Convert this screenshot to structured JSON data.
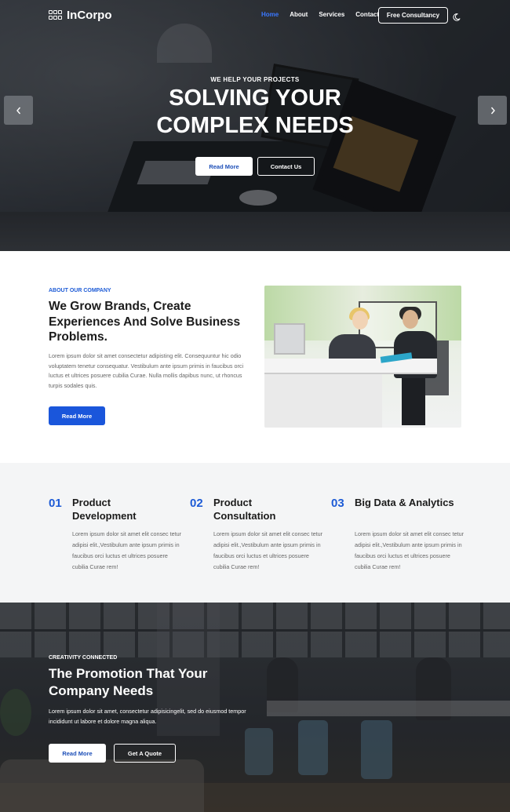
{
  "nav": {
    "brand": "InCorpo",
    "links": [
      "Home",
      "About",
      "Services",
      "Contact"
    ],
    "active_link": "Home",
    "cta_label": "Free Consultancy",
    "theme_icon": "moon-icon"
  },
  "hero": {
    "subtitle": "WE HELP YOUR PROJECTS",
    "title_line1": "SOLVING YOUR",
    "title_line2": "COMPLEX NEEDS",
    "primary_button": "Read More",
    "secondary_button": "Contact Us",
    "prev_icon": "chevron-left-icon",
    "next_icon": "chevron-right-icon"
  },
  "about": {
    "eyebrow": "ABOUT OUR COMPANY",
    "title": "We Grow Brands, Create Experiences And Solve Business Problems.",
    "text": "Lorem ipsum dolor sit amet consectetur adipisting elit. Consequuntur hic odio voluptatem tenetur consequatur. Vestibulum ante ipsum primis in faucibus orci luctus et ultrices posuere cubilia Curae. Nulla mollis dapibus nunc, ut rhoncus turpis sodales quis.",
    "button": "Read More"
  },
  "services": [
    {
      "number": "01",
      "title": "Product Development",
      "text": "Lorem ipsum dolor sit amet elit consec tetur adipisi elit.,Vestibulum ante ipsum primis in faucibus orci luctus et ultrices posuere cubilia Curae rem!"
    },
    {
      "number": "02",
      "title": "Product Consultation",
      "text": "Lorem ipsum dolor sit amet elit consec tetur adipisi elit.,Vestibulum ante ipsum primis in faucibus orci luctus et ultrices posuere cubilia Curae rem!"
    },
    {
      "number": "03",
      "title": "Big Data & Analytics",
      "text": "Lorem ipsum dolor sit amet elit consec tetur adipisi elit.,Vestibulum ante ipsum primis in faucibus orci luctus et ultrices posuere cubilia Curae rem!"
    }
  ],
  "promo": {
    "eyebrow": "CREATIVITY CONNECTED",
    "title": "The Promotion That Your Company Needs",
    "text": "Lorem ipsum dolor sit amet, consectetur adipisicingelit, sed do eiusmod tempor incididunt ut labore et dolore magna aliqua.",
    "primary_button": "Read More",
    "secondary_button": "Get A Quote"
  },
  "colors": {
    "accent": "#1a56db",
    "active_nav": "#3a78ff",
    "services_bg": "#f4f5f6"
  }
}
